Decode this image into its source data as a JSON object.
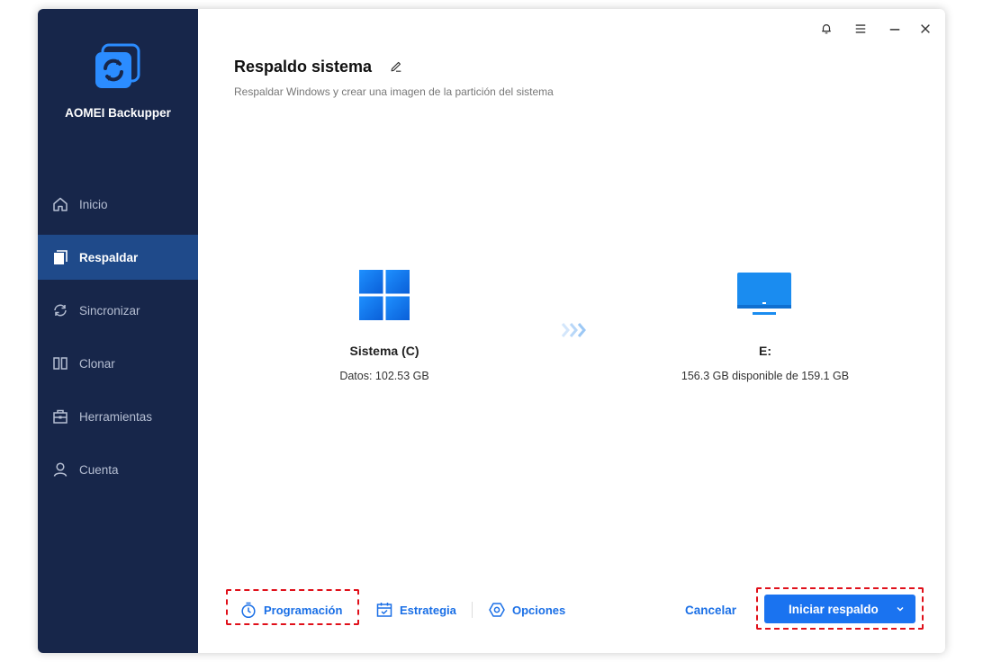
{
  "app": {
    "name": "AOMEI Backupper"
  },
  "sidebar": {
    "items": [
      {
        "label": "Inicio",
        "icon": "home-icon",
        "active": false
      },
      {
        "label": "Respaldar",
        "icon": "backup-icon",
        "active": true
      },
      {
        "label": "Sincronizar",
        "icon": "sync-icon",
        "active": false
      },
      {
        "label": "Clonar",
        "icon": "clone-icon",
        "active": false
      },
      {
        "label": "Herramientas",
        "icon": "toolbox-icon",
        "active": false
      },
      {
        "label": "Cuenta",
        "icon": "user-icon",
        "active": false
      }
    ]
  },
  "page": {
    "title": "Respaldo sistema",
    "subtitle": "Respaldar Windows y crear una imagen de la partición del sistema"
  },
  "source": {
    "name": "Sistema (C)",
    "info": "Datos: 102.53 GB"
  },
  "destination": {
    "name": "E:",
    "info": "156.3 GB disponible de 159.1 GB"
  },
  "footer": {
    "schedule_label": "Programación",
    "strategy_label": "Estrategia",
    "options_label": "Opciones",
    "cancel_label": "Cancelar",
    "start_label": "Iniciar respaldo"
  },
  "colors": {
    "sidebar_bg": "#17264a",
    "sidebar_active": "#1f4a8a",
    "accent": "#1a73f0",
    "highlight": "#e0101a"
  }
}
